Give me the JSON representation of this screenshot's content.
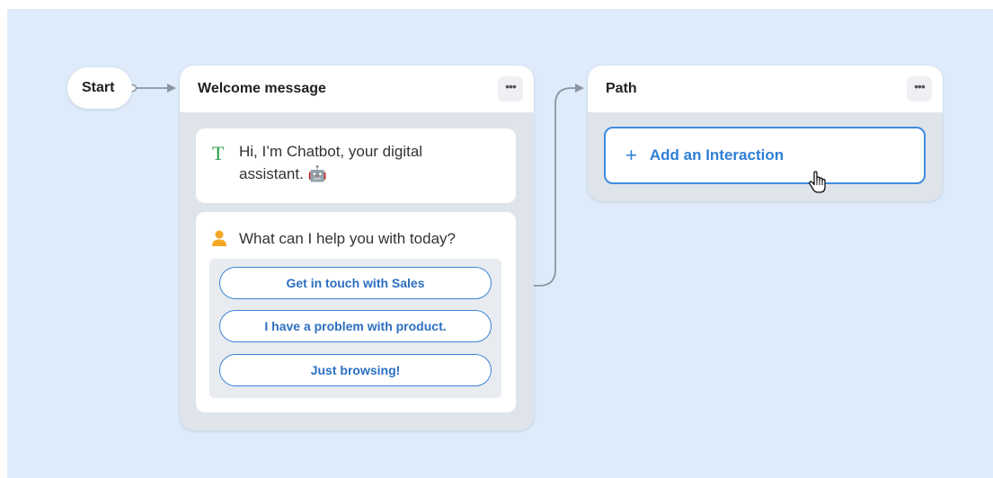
{
  "start": {
    "label": "Start"
  },
  "welcome": {
    "title": "Welcome message",
    "more_label": "•••",
    "message_icon": "T",
    "message_text": "Hi, I’m Chatbot, your digital assistant. 🤖",
    "question_text": "What can I help you with today?",
    "choices": [
      {
        "label": "Get in touch with Sales"
      },
      {
        "label": "I have a problem with product."
      },
      {
        "label": "Just browsing!"
      }
    ]
  },
  "path": {
    "title": "Path",
    "more_label": "•••",
    "add_icon": "+",
    "add_label": "Add an Interaction"
  },
  "colors": {
    "canvas": "#deebfa",
    "accent": "#3f8be0",
    "text_icon": "#2a9d4a",
    "person_icon": "#f5a623"
  },
  "icons": [
    "text-icon",
    "person-icon",
    "more-icon",
    "plus-icon",
    "hand-cursor-icon"
  ]
}
